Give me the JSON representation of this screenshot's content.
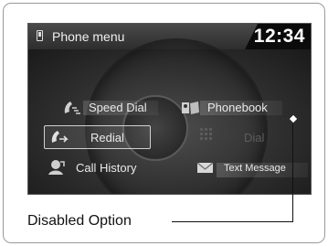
{
  "title": "Phone menu",
  "clock": "12:34",
  "menu": {
    "speed_dial": "Speed Dial",
    "phonebook": "Phonebook",
    "redial": "Redial",
    "dial": "Dial",
    "call_history": "Call History",
    "text_message": "Text Message"
  },
  "selected_item": "Redial",
  "disabled_item": "Dial",
  "callout": "Disabled Option"
}
